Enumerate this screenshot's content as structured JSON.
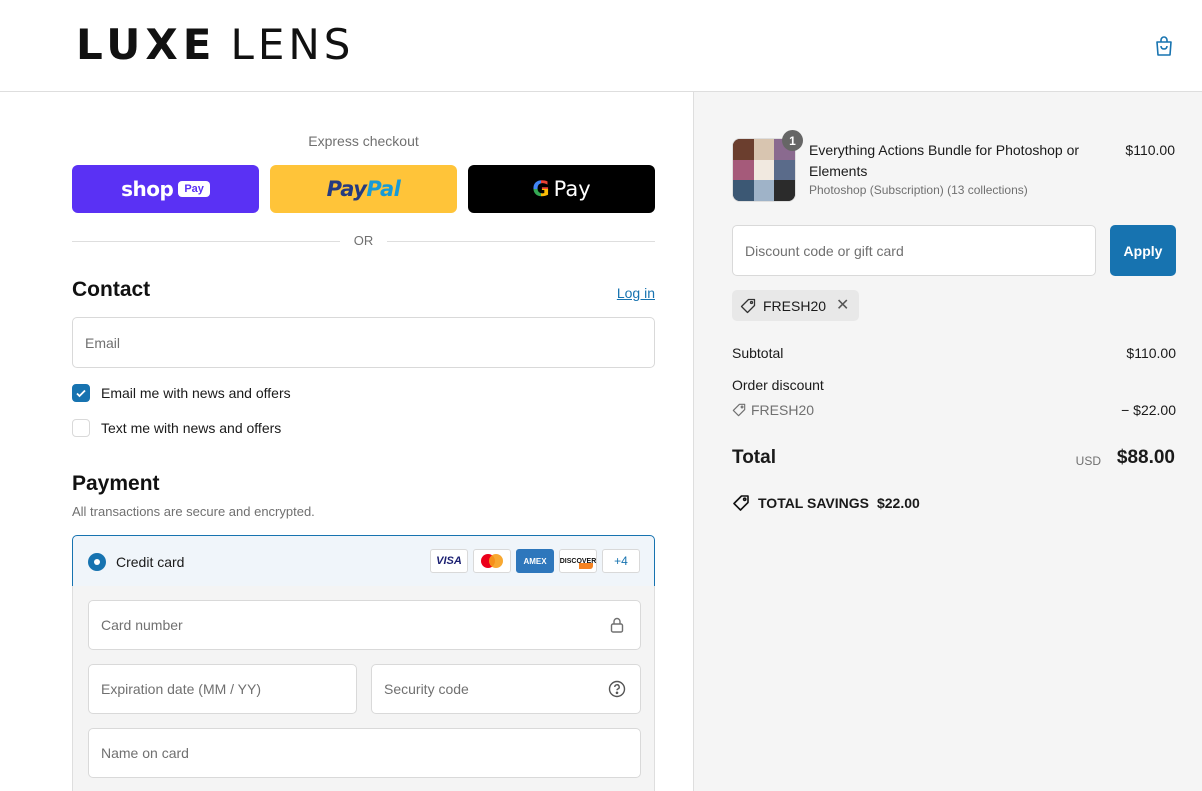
{
  "header": {
    "logo_bold": "LUXE",
    "logo_light": "LENS",
    "cart_icon": "shopping-bag-icon"
  },
  "express": {
    "label": "Express checkout",
    "shop_pay_text": "shop",
    "shop_pay_badge": "Pay",
    "paypal_part1": "Pay",
    "paypal_part2": "Pal",
    "gpay_g": "G",
    "gpay_text": "Pay",
    "or_text": "OR"
  },
  "contact": {
    "title": "Contact",
    "login_link": "Log in",
    "email_placeholder": "Email",
    "email_value": "",
    "news_label": "Email me with news and offers",
    "news_checked": true,
    "sms_label": "Text me with news and offers",
    "sms_checked": false
  },
  "payment": {
    "title": "Payment",
    "subtitle": "All transactions are secure and encrypted.",
    "method_label": "Credit card",
    "card_logos": [
      "VISA",
      "mastercard",
      "AMEX",
      "DISCOVER"
    ],
    "more_cards": "+4",
    "card_number_placeholder": "Card number",
    "expiry_placeholder": "Expiration date (MM / YY)",
    "cvc_placeholder": "Security code",
    "name_placeholder": "Name on card"
  },
  "summary": {
    "product_title": "Everything Actions Bundle for Photoshop or Elements",
    "product_variant": "Photoshop (Subscription) (13 collections)",
    "product_price": "$110.00",
    "quantity": "1",
    "discount_placeholder": "Discount code or gift card",
    "apply_label": "Apply",
    "applied_code": "FRESH20",
    "subtotal_label": "Subtotal",
    "subtotal_value": "$110.00",
    "order_discount_label": "Order discount",
    "discount_code": "FRESH20",
    "discount_value": "− $22.00",
    "total_label": "Total",
    "currency": "USD",
    "total_value": "$88.00",
    "savings_label": "TOTAL SAVINGS",
    "savings_value": "$22.00"
  },
  "colors": {
    "accent": "#1773b0",
    "shop_pay": "#5a31f4",
    "paypal": "#ffc439",
    "gpay": "#000000",
    "summary_bg": "#f5f5f5"
  }
}
